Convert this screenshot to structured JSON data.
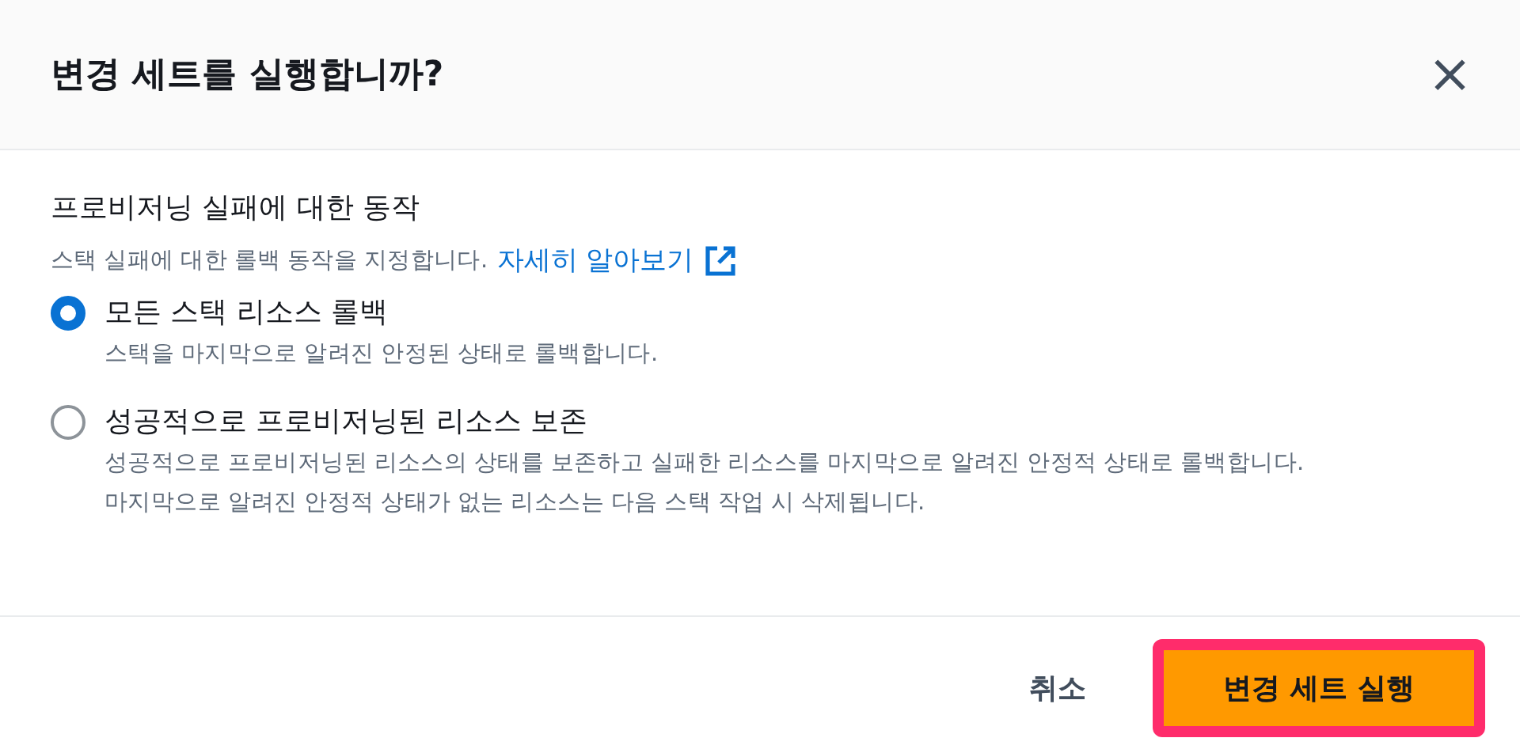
{
  "dialog": {
    "title": "변경 세트를 실행합니까?",
    "close": "×"
  },
  "section": {
    "label": "프로비저닝 실패에 대한 동작",
    "description": "스택 실패에 대한 롤백 동작을 지정합니다.",
    "link": "자세히 알아보기"
  },
  "options": [
    {
      "label": "모든 스택 리소스 롤백",
      "description": [
        "스택을 마지막으로 알려진 안정된 상태로 롤백합니다."
      ],
      "selected": true
    },
    {
      "label": "성공적으로 프로비저닝된 리소스 보존",
      "description": [
        "성공적으로 프로비저닝된 리소스의 상태를 보존하고 실패한 리소스를 마지막으로 알려진 안정적 상태로 롤백합니다.",
        "마지막으로 알려진 안정적 상태가 없는 리소스는 다음 스택 작업 시 삭제됩니다."
      ],
      "selected": false
    }
  ],
  "buttons": {
    "cancel": "취소",
    "primary": "변경 세트 실행"
  }
}
